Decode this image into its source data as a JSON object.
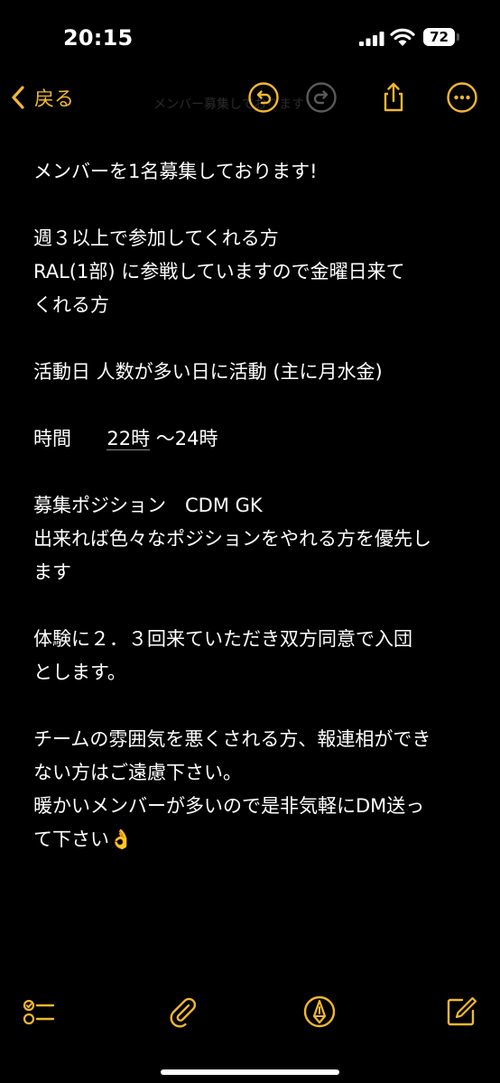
{
  "status": {
    "time": "20:15",
    "battery": "72"
  },
  "nav": {
    "back_label": "戻る",
    "faded_title": "メンバー募集しております"
  },
  "note": {
    "lines": [
      "メンバーを1名募集しております!",
      "",
      "週３以上で参加してくれる方",
      "RAL(1部) に参戦していますので金曜日来て",
      "くれる方",
      "",
      "活動日 人数が多い日に活動 (主に月水金)",
      "",
      "",
      "",
      "募集ポジション　CDM GK",
      "出来れば色々なポジションをやれる方を優先し",
      "ます",
      "",
      "体験に２．３回来ていただき双方同意で入団",
      "とします。",
      "",
      "チームの雰囲気を悪くされる方、報連相ができ",
      "ない方はご遠慮下さい。",
      "暖かいメンバーが多いので是非気軽にDM送っ",
      "て下さい👌"
    ],
    "time_line": {
      "label": "時間",
      "start": "22時",
      "rest": "〜24時"
    }
  },
  "colors": {
    "accent": "#f2b731",
    "background": "#000000",
    "text": "#ffffff",
    "disabled": "#5a5a5a"
  },
  "icons": {
    "undo": "undo-icon",
    "redo": "redo-icon",
    "share": "share-icon",
    "more": "more-icon",
    "checklist": "checklist-icon",
    "attach": "paperclip-icon",
    "markup": "markup-pen-icon",
    "compose": "compose-icon"
  }
}
